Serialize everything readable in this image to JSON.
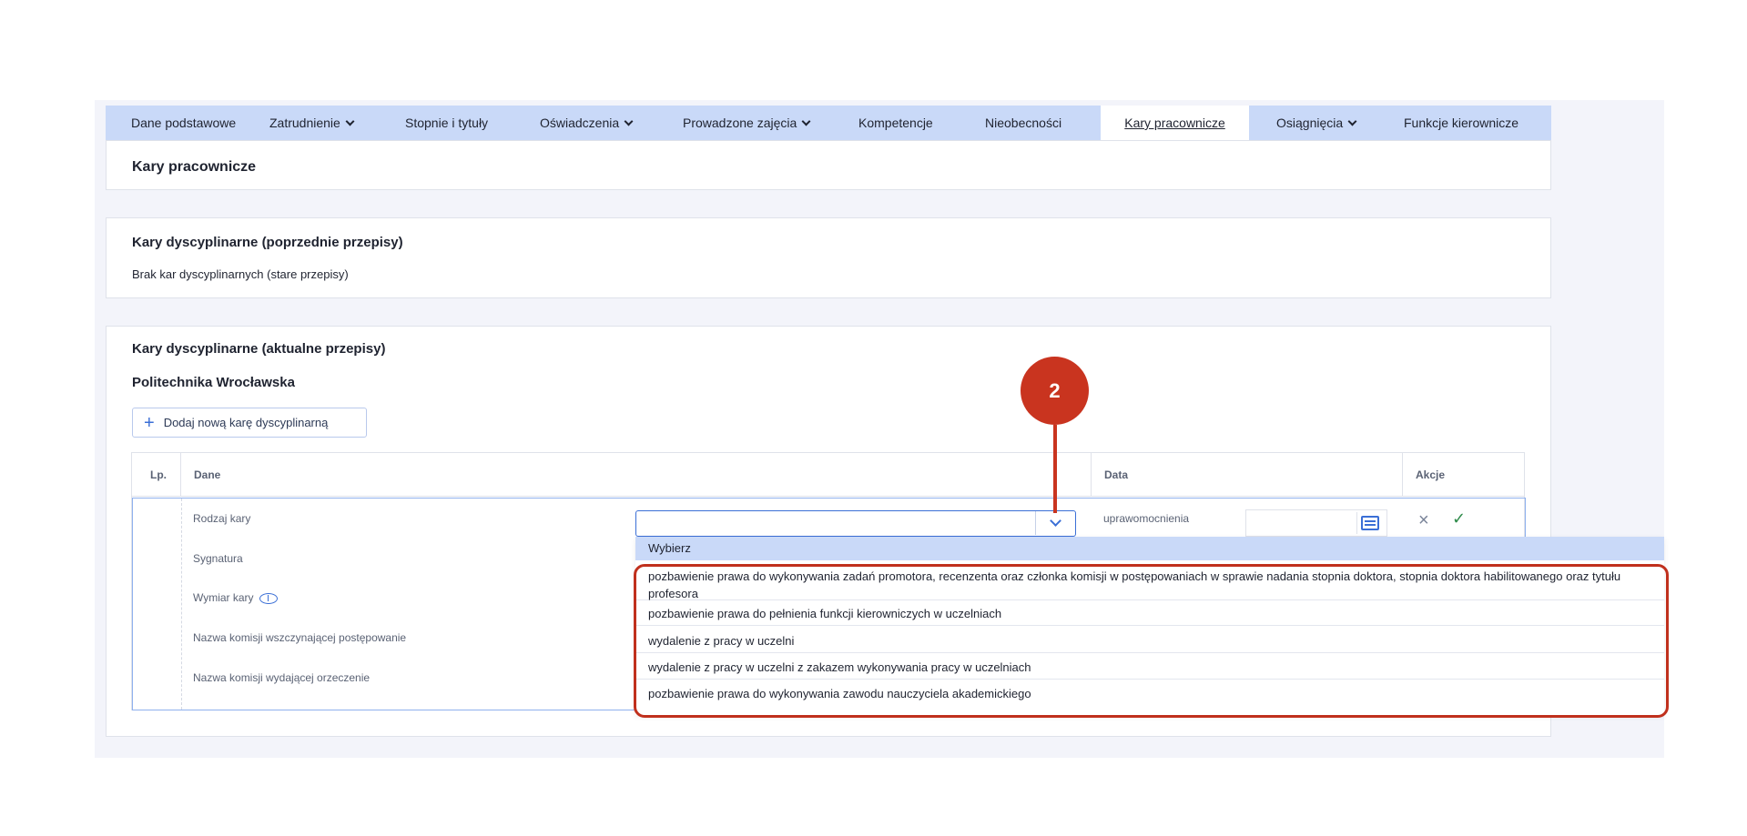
{
  "tabs": [
    {
      "label": "Dane podstawowe",
      "dropdown": false
    },
    {
      "label": "Zatrudnienie",
      "dropdown": true
    },
    {
      "label": "Stopnie i tytuły",
      "dropdown": false
    },
    {
      "label": "Oświadczenia",
      "dropdown": true
    },
    {
      "label": "Prowadzone zajęcia",
      "dropdown": true
    },
    {
      "label": "Kompetencje",
      "dropdown": false
    },
    {
      "label": "Nieobecności",
      "dropdown": false
    },
    {
      "label": "Kary pracownicze",
      "dropdown": false,
      "active": true
    },
    {
      "label": "Osiągnięcia",
      "dropdown": true
    },
    {
      "label": "Funkcje kierownicze",
      "dropdown": false
    }
  ],
  "page_title": "Kary pracownicze",
  "old_section": {
    "title": "Kary dyscyplinarne (poprzednie przepisy)",
    "empty_text": "Brak kar dyscyplinarnych (stare przepisy)"
  },
  "current_section": {
    "title": "Kary dyscyplinarne (aktualne przepisy)",
    "institution": "Politechnika Wrocławska",
    "add_button": "Dodaj nową karę dyscyplinarną"
  },
  "table": {
    "headers": {
      "lp": "Lp.",
      "dane": "Dane",
      "data": "Data",
      "akcje": "Akcje"
    },
    "fields": {
      "rodzaj": "Rodzaj kary",
      "sygnatura": "Sygnatura",
      "wymiar": "Wymiar kary",
      "komisja_wszczynajaca": "Nazwa komisji wszczynającej postępowanie",
      "komisja_wydajaca": "Nazwa komisji wydającej orzeczenie"
    },
    "date_label": "uprawomocnienia"
  },
  "dropdown": {
    "placeholder": "Wybierz",
    "options": [
      "pozbawienie prawa do wykonywania zadań promotora, recenzenta oraz członka komisji w postępowaniach w sprawie nadania stopnia doktora, stopnia doktora habilitowanego oraz tytułu profesora",
      "pozbawienie prawa do pełnienia funkcji kierowniczych w uczelniach",
      "wydalenie z pracy w uczelni",
      "wydalenie z pracy w uczelni z zakazem wykonywania pracy w uczelniach",
      "pozbawienie prawa do wykonywania zawodu nauczyciela akademickiego"
    ]
  },
  "callout": {
    "number": "2"
  },
  "colors": {
    "accent": "#3b6fd6",
    "tabbar": "#c9d9f8",
    "callout": "#c9341f"
  }
}
